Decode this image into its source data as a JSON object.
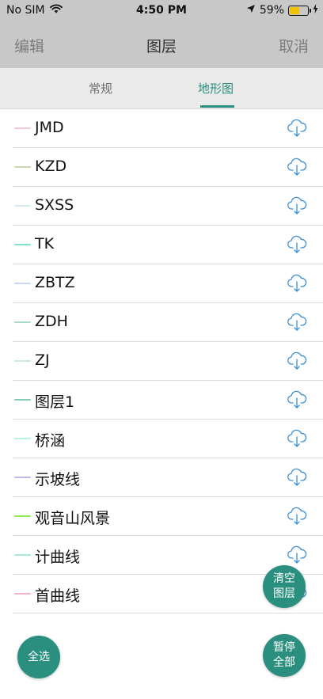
{
  "status_bar": {
    "carrier": "No SIM",
    "time": "4:50 PM",
    "battery": "59%",
    "battery_level": 0.59
  },
  "nav": {
    "left": "编辑",
    "title": "图层",
    "right": "取消"
  },
  "tabs": [
    {
      "label": "常规",
      "active": false
    },
    {
      "label": "地形图",
      "active": true
    }
  ],
  "layers": [
    {
      "name": "JMD",
      "color": "#f4c7d2"
    },
    {
      "name": "KZD",
      "color": "#c8d8b4"
    },
    {
      "name": "SXSS",
      "color": "#d6ecef"
    },
    {
      "name": "TK",
      "color": "#7ee2cf"
    },
    {
      "name": "ZBTZ",
      "color": "#c7d8f4"
    },
    {
      "name": "ZDH",
      "color": "#a6dcc8"
    },
    {
      "name": "ZJ",
      "color": "#c7ead3"
    },
    {
      "name": "图层1",
      "color": "#86cdb8"
    },
    {
      "name": "桥涵",
      "color": "#b7f2e6"
    },
    {
      "name": "示坡线",
      "color": "#c2b6ea"
    },
    {
      "name": "观音山风景",
      "color": "#8fea5a"
    },
    {
      "name": "计曲线",
      "color": "#a8ead1"
    },
    {
      "name": "首曲线",
      "color": "#f2b3c6"
    }
  ],
  "icons": {
    "download": "cloud-download-icon",
    "wifi": "wifi-icon",
    "location": "location-arrow-icon",
    "battery": "battery-icon",
    "charging": "charging-bolt-icon"
  },
  "buttons": {
    "clear_layers": "清空图层",
    "pause_all": "暂停全部",
    "select_all": "全选"
  },
  "colors": {
    "accent": "#2a8f7f",
    "nav_bg": "#c8c8c8",
    "tab_bg": "#eaeaea",
    "icon_blue": "#3a8fd6",
    "battery_fill": "#f2c200"
  }
}
